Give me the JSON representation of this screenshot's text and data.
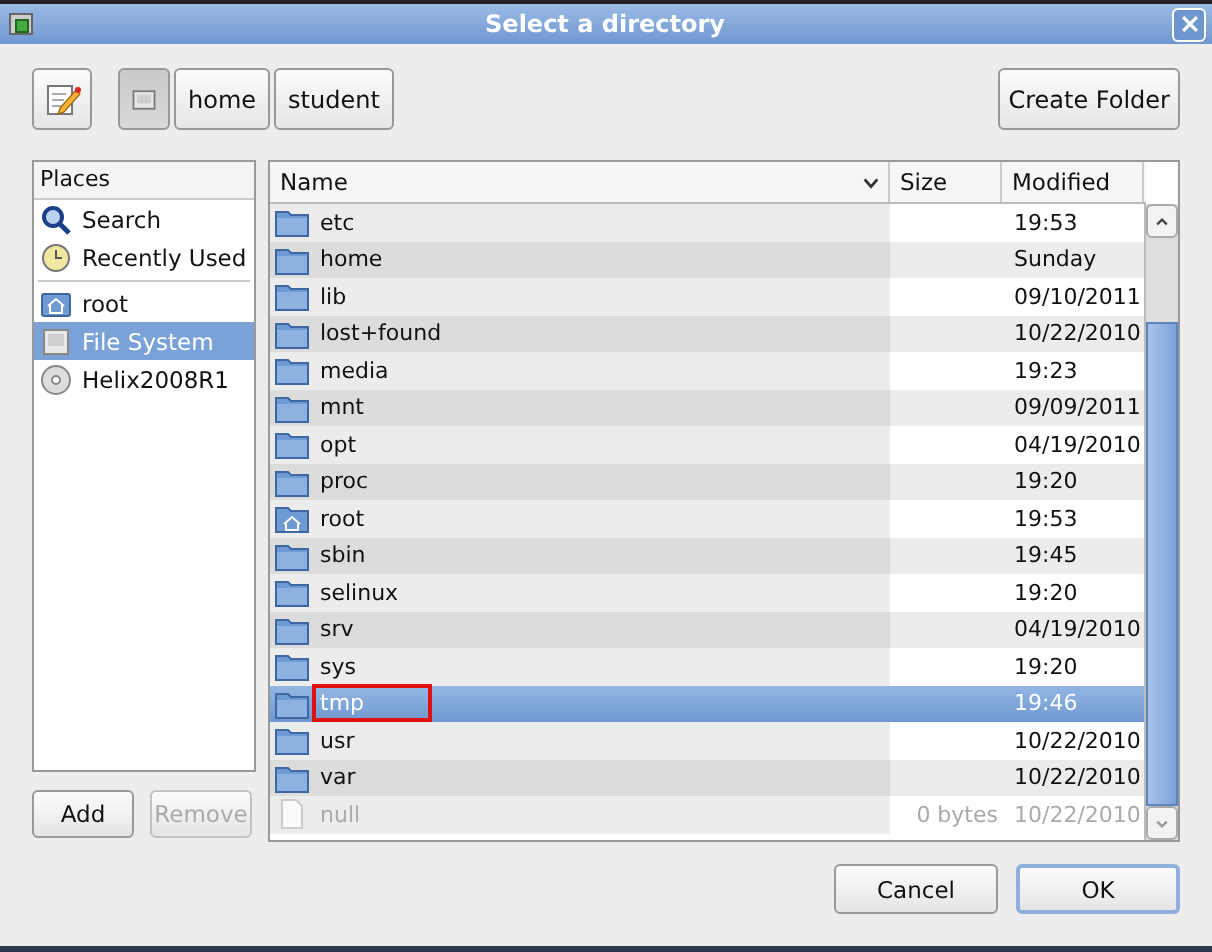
{
  "window": {
    "title": "Select a directory"
  },
  "path_bar": [
    {
      "kind": "drive",
      "selected": true
    },
    {
      "kind": "text",
      "label": "home",
      "selected": false
    },
    {
      "kind": "text",
      "label": "student",
      "selected": false
    }
  ],
  "create_folder_button": "Create Folder",
  "places": {
    "heading": "Places",
    "groups": [
      [
        {
          "kind": "search",
          "label": "Search",
          "selected": false
        },
        {
          "kind": "recent",
          "label": "Recently Used",
          "selected": false
        }
      ],
      [
        {
          "kind": "home",
          "label": "root",
          "selected": false
        },
        {
          "kind": "drive",
          "label": "File System",
          "selected": true
        },
        {
          "kind": "disc",
          "label": "Helix2008R1",
          "selected": false
        }
      ]
    ]
  },
  "places_buttons": [
    {
      "label": "Add",
      "disabled": false
    },
    {
      "label": "Remove",
      "disabled": true
    }
  ],
  "table": {
    "columns": [
      "Name",
      "Size",
      "Modified"
    ],
    "rows": [
      {
        "kind": "folder",
        "name": "etc",
        "modified": "19:53",
        "selected": false
      },
      {
        "kind": "folder",
        "name": "home",
        "modified": "Sunday",
        "selected": false
      },
      {
        "kind": "folder",
        "name": "lib",
        "modified": "09/10/2011",
        "selected": false
      },
      {
        "kind": "folder",
        "name": "lost+found",
        "modified": "10/22/2010",
        "selected": false
      },
      {
        "kind": "folder",
        "name": "media",
        "modified": "19:23",
        "selected": false
      },
      {
        "kind": "folder",
        "name": "mnt",
        "modified": "09/09/2011",
        "selected": false
      },
      {
        "kind": "folder",
        "name": "opt",
        "modified": "04/19/2010",
        "selected": false
      },
      {
        "kind": "folder",
        "name": "proc",
        "modified": "19:20",
        "selected": false
      },
      {
        "kind": "home",
        "name": "root",
        "modified": "19:53",
        "selected": false
      },
      {
        "kind": "folder",
        "name": "sbin",
        "modified": "19:45",
        "selected": false
      },
      {
        "kind": "folder",
        "name": "selinux",
        "modified": "19:20",
        "selected": false
      },
      {
        "kind": "folder",
        "name": "srv",
        "modified": "04/19/2010",
        "selected": false
      },
      {
        "kind": "folder",
        "name": "sys",
        "modified": "19:20",
        "selected": false
      },
      {
        "kind": "folder",
        "name": "tmp",
        "modified": "19:46",
        "selected": true,
        "highlighted": true
      },
      {
        "kind": "folder",
        "name": "usr",
        "modified": "10/22/2010",
        "selected": false
      },
      {
        "kind": "folder",
        "name": "var",
        "modified": "10/22/2010",
        "selected": false
      },
      {
        "kind": "file",
        "name": "null",
        "size": "0 bytes",
        "modified": "10/22/2010",
        "selected": false,
        "disabled": true
      }
    ]
  },
  "dialog_buttons": [
    {
      "label": "Cancel",
      "default": false
    },
    {
      "label": "OK",
      "default": true
    }
  ]
}
